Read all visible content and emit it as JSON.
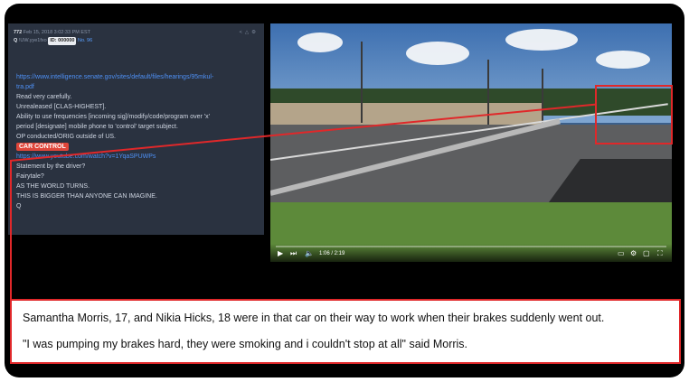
{
  "post": {
    "number": "772",
    "datetime": "Feb 15, 2018 3:02:33 PM EST",
    "author": "Q",
    "trip": "!UW.yye1fxo",
    "id_label": "ID: 000000",
    "post_no": "No. 96",
    "icons": [
      "share-icon",
      "warning-icon",
      "settings-icon"
    ],
    "lines": [
      "https://www.intelligence.senate.gov/sites/default/files/hearings/95mkul-",
      "tra.pdf",
      "Read very carefully.",
      "Unrealeased [CLAS-HIGHEST].",
      "Ability to use frequencies [incoming sig]/modify/code/program over 'x'",
      "period [designate] mobile phone to 'control' target subject.",
      "OP conducted/ORIG outside of US.",
      "CAR CONTROL",
      "https://www.youtube.com/watch?v=1YqaSPUWPs",
      "Statement by the driver?",
      "Fairytale?",
      "AS THE WORLD TURNS.",
      "THIS IS BIGGER THAN ANYONE CAN IMAGINE.",
      "Q"
    ]
  },
  "video": {
    "time": "1:06 / 2:19"
  },
  "caption": {
    "line1": "Samantha Morris, 17, and Nikia Hicks, 18 were in that car on their way to work when their brakes suddenly went out.",
    "line2": "\"I was pumping my brakes hard, they were smoking and i couldn't stop at all\" said Morris."
  },
  "colors": {
    "highlight": "#e0282a",
    "link": "#4e90f5",
    "tag": "#e0463a"
  }
}
